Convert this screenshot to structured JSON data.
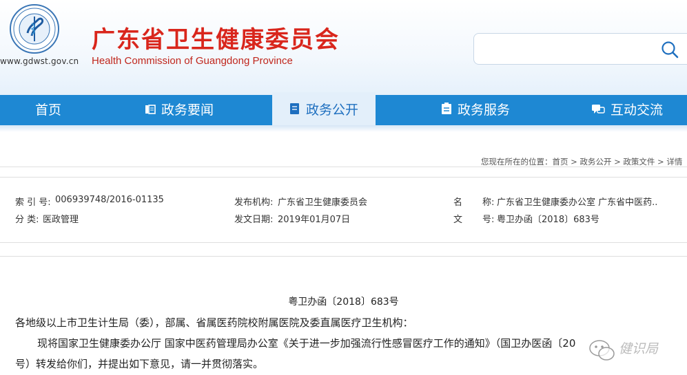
{
  "header": {
    "logo_icon": "health-commission-emblem-icon",
    "site_url": "www.gdwst.gov.cn",
    "title_cn": "广东省卫生健康委员会",
    "title_en": "Health Commission of Guangdong Province",
    "search": {
      "value": "",
      "placeholder": "",
      "icon": "search-icon"
    }
  },
  "nav": {
    "items": [
      {
        "label": "首页",
        "icon": ""
      },
      {
        "label": "政务要闻",
        "icon": "news-icon"
      },
      {
        "label": "政务公开",
        "icon": "document-icon",
        "active": true
      },
      {
        "label": "政务服务",
        "icon": "clipboard-icon"
      },
      {
        "label": "互动交流",
        "icon": "chat-icon"
      }
    ],
    "accent": "#1e88d3",
    "active_bg": "#e3effa"
  },
  "breadcrumb": {
    "prefix": "您现在所在的位置：",
    "items": [
      "首页",
      "政务公开",
      "政策文件",
      "详情"
    ],
    "separator": " > "
  },
  "doc_info": {
    "index_label": "索 引 号:",
    "index_value": "006939748/2016-01135",
    "category_label": "分 类:",
    "category_value": "医政管理",
    "publisher_label": "发布机构:",
    "publisher_value": "广东省卫生健康委员会",
    "date_label": "发文日期:",
    "date_value": "2019年01月07日",
    "name_label_1": "名",
    "name_label_2": "称:",
    "name_value": "广东省卫生健康委办公室 广东省中医药..",
    "docno_label_1": "文",
    "docno_label_2": "号:",
    "docno_value": "粤卫办函〔2018〕683号"
  },
  "article": {
    "doc_number": "粤卫办函〔2018〕683号",
    "addressee": "各地级以上市卫生计生局（委），部属、省属医药院校附属医院及委直属医疗卫生机构：",
    "para1_line1": "现将国家卫生健康委办公厅 国家中医药管理局办公室《关于进一步加强流行性感冒医疗工作的通知》（国卫办医函〔20",
    "para1_line2": "号）转发给你们，并提出如下意见，请一并贯彻落实。"
  },
  "watermark": {
    "icon": "wechat-icon",
    "text": "健识局"
  }
}
